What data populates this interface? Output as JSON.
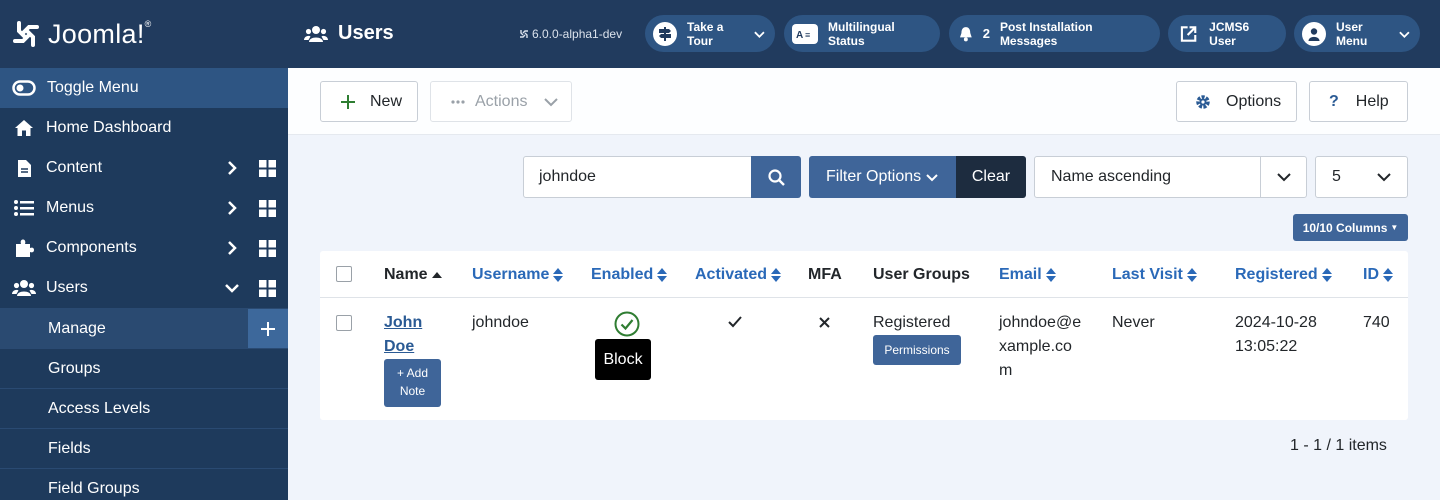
{
  "brand": {
    "logo_text": "Joomla!",
    "trademark": "®"
  },
  "sidebar": {
    "toggle_label": "Toggle Menu",
    "items": [
      {
        "label": "Home Dashboard"
      },
      {
        "label": "Content"
      },
      {
        "label": "Menus"
      },
      {
        "label": "Components"
      },
      {
        "label": "Users"
      }
    ],
    "subitems": [
      {
        "label": "Manage"
      },
      {
        "label": "Groups"
      },
      {
        "label": "Access Levels"
      },
      {
        "label": "Fields"
      },
      {
        "label": "Field Groups"
      }
    ]
  },
  "header": {
    "title": "Users",
    "version": "6.0.0-alpha1-dev",
    "buttons": {
      "tour": "Take a Tour",
      "multilingual": "Multilingual Status",
      "post_install_count": "2",
      "post_install": "Post Installation Messages",
      "site": "JCMS6 User",
      "user_menu": "User Menu"
    }
  },
  "toolbar": {
    "new_label": "New",
    "actions_label": "Actions",
    "options_label": "Options",
    "help_label": "Help"
  },
  "filters": {
    "search_value": "johndoe",
    "filter_options_label": "Filter Options",
    "clear_label": "Clear",
    "ordering_value": "Name ascending",
    "limit_value": "5",
    "columns_label": "10/10 Columns"
  },
  "table": {
    "headers": {
      "name": "Name",
      "username": "Username",
      "enabled": "Enabled",
      "activated": "Activated",
      "mfa": "MFA",
      "user_groups": "User Groups",
      "email": "Email",
      "last_visit": "Last Visit",
      "registered": "Registered",
      "id": "ID"
    },
    "row": {
      "name_line1": "John",
      "name_line2": "Doe",
      "add_note_line1": "Add",
      "add_note_line2": "Note",
      "username": "johndoe",
      "enabled_tooltip": "Block",
      "user_group": "Registered",
      "permissions_label": "Permissions",
      "email_line1": "johndoe@e",
      "email_line2": "xample.co",
      "email_line3": "m",
      "last_visit": "Never",
      "registered_date": "2024-10-28",
      "registered_time": "13:05:22",
      "id": "740"
    }
  },
  "pagination": {
    "text": "1 - 1 / 1 items"
  },
  "colors": {
    "sidebar": "#1e3a5c",
    "header": "#213b5e",
    "primary": "#3f6599",
    "link": "#2a69b8",
    "success": "#2f7d32"
  }
}
